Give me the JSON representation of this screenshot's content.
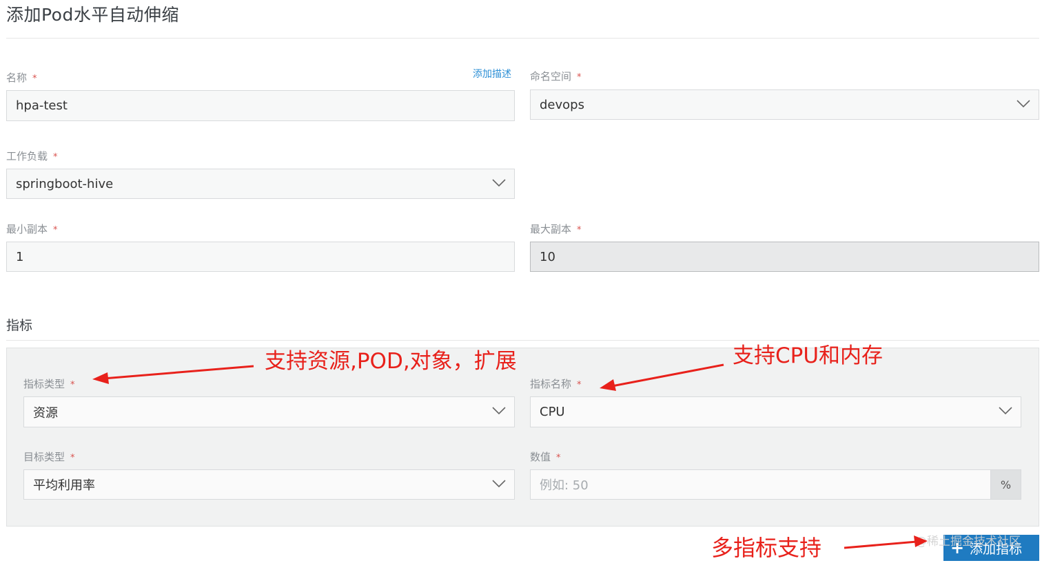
{
  "page_title": "添加Pod水平自动伸缩",
  "form": {
    "name": {
      "label": "名称",
      "required": "*",
      "value": "hpa-test",
      "add_desc_link": "添加描述"
    },
    "namespace": {
      "label": "命名空间",
      "required": "*",
      "value": "devops"
    },
    "workload": {
      "label": "工作负载",
      "required": "*",
      "value": "springboot-hive"
    },
    "min_replicas": {
      "label": "最小副本",
      "required": "*",
      "value": "1"
    },
    "max_replicas": {
      "label": "最大副本",
      "required": "*",
      "value": "10"
    }
  },
  "metrics": {
    "section_title": "指标",
    "metric_type": {
      "label": "指标类型",
      "required": "*",
      "value": "资源"
    },
    "metric_name": {
      "label": "指标名称",
      "required": "*",
      "value": "CPU"
    },
    "target_type": {
      "label": "目标类型",
      "required": "*",
      "value": "平均利用率"
    },
    "value": {
      "label": "数值",
      "required": "*",
      "placeholder": "例如: 50",
      "unit": "%"
    },
    "add_button": "添加指标"
  },
  "watermark": "@稀土掘金技术社区",
  "annotations": {
    "metric_type_note": "支持资源,POD,对象，扩展",
    "metric_name_note": "支持CPU和内存",
    "multi_metric_note": "多指标支持"
  },
  "colors": {
    "accent": "#1f7bc1",
    "link": "#2c8fd6",
    "required": "#d9534f",
    "annotation": "#e8211b"
  }
}
